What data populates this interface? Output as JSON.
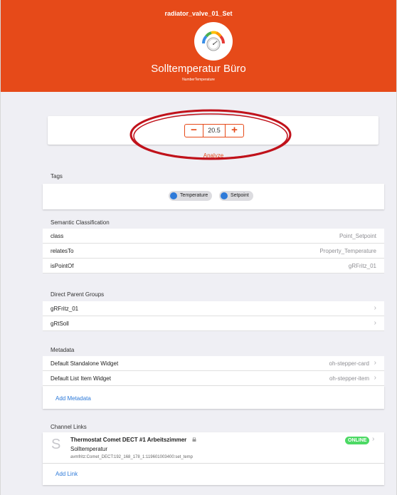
{
  "header": {
    "item_name": "radiator_valve_01_Set",
    "label": "Solltemperatur Büro",
    "type": "NumberTemperature",
    "icon": "gauge-icon",
    "bg_color": "#e64a19"
  },
  "stepper": {
    "minus": "−",
    "value": "20.5",
    "plus": "+",
    "analyze": "Analyze"
  },
  "tags": {
    "title": "Tags",
    "items": [
      "Temperature",
      "Setpoint"
    ]
  },
  "semantic": {
    "title": "Semantic Classification",
    "rows": [
      {
        "key": "class",
        "value": "Point_Setpoint"
      },
      {
        "key": "relatesTo",
        "value": "Property_Temperature"
      },
      {
        "key": "isPointOf",
        "value": "gRFritz_01"
      }
    ]
  },
  "groups": {
    "title": "Direct Parent Groups",
    "items": [
      "gRFritz_01",
      "gRtSoll"
    ]
  },
  "metadata": {
    "title": "Metadata",
    "rows": [
      {
        "key": "Default Standalone Widget",
        "value": "oh-stepper-card"
      },
      {
        "key": "Default List Item Widget",
        "value": "oh-stepper-item"
      }
    ],
    "add": "Add Metadata"
  },
  "channels": {
    "title": "Channel Links",
    "avatar": "S",
    "thing": "Thermostat Comet DECT #1 Arbeitszimmer",
    "channel": "Solltemperatur",
    "uid": "avmfritz:Comet_DECT:192_168_178_1:119601003400:set_temp",
    "status": "ONLINE",
    "add": "Add Link"
  },
  "colors": {
    "accent": "#e64a19",
    "link": "#2d7ad9",
    "online": "#4cd964",
    "annotation": "#c0121b"
  }
}
